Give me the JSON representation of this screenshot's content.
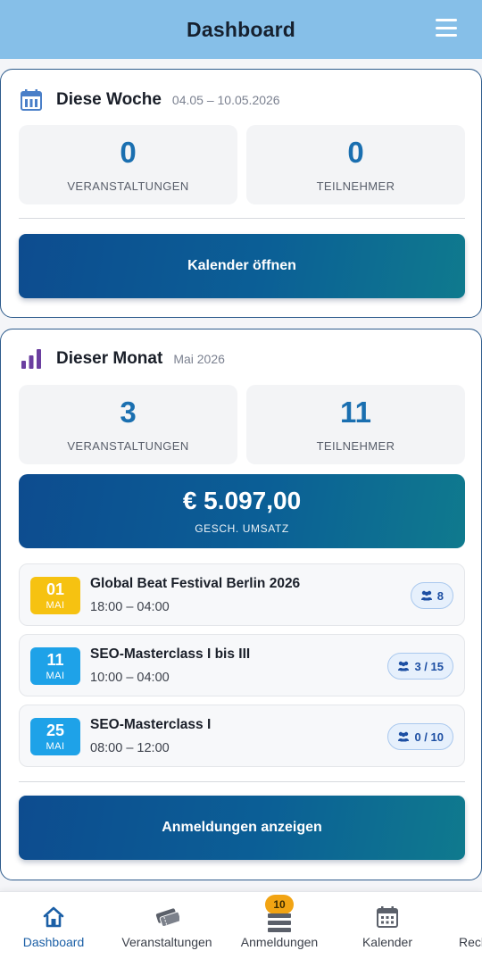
{
  "header": {
    "title": "Dashboard",
    "menu_icon": "hamburger-icon"
  },
  "week": {
    "title": "Diese Woche",
    "range": "04.05 – 10.05.2026",
    "events_count": "0",
    "events_label": "VERANSTALTUNGEN",
    "participants_count": "0",
    "participants_label": "TEILNEHMER",
    "button": "Kalender öffnen"
  },
  "month": {
    "title": "Dieser Monat",
    "period": "Mai 2026",
    "events_count": "3",
    "events_label": "VERANSTALTUNGEN",
    "participants_count": "11",
    "participants_label": "TEILNEHMER",
    "revenue": "€ 5.097,00",
    "revenue_label": "GESCH. UMSATZ",
    "events": [
      {
        "day": "01",
        "month": "MAI",
        "name": "Global Beat Festival Berlin 2026",
        "time": "18:00 – 04:00",
        "participants": "8",
        "color": "#f6c211"
      },
      {
        "day": "11",
        "month": "MAI",
        "name": "SEO-Masterclass I bis III",
        "time": "10:00 – 04:00",
        "participants": "3 / 15",
        "color": "#1ea2e8"
      },
      {
        "day": "25",
        "month": "MAI",
        "name": "SEO-Masterclass I",
        "time": "08:00 – 12:00",
        "participants": "0 / 10",
        "color": "#1ea2e8"
      }
    ],
    "button": "Anmeldungen anzeigen"
  },
  "bottom_nav": [
    {
      "label": "Dashboard",
      "icon": "home-icon",
      "active": true
    },
    {
      "label": "Veranstaltungen",
      "icon": "tickets-icon"
    },
    {
      "label": "Anmeldungen",
      "icon": "registrations-icon",
      "badge": "10"
    },
    {
      "label": "Kalender",
      "icon": "calendar-icon"
    },
    {
      "label": "Rech",
      "icon": "invoice-icon"
    }
  ],
  "colors": {
    "accent": "#1a6fb0",
    "header_bg": "#86bfe8",
    "card_border": "#2d5b8c",
    "purple": "#6b3fa0"
  }
}
